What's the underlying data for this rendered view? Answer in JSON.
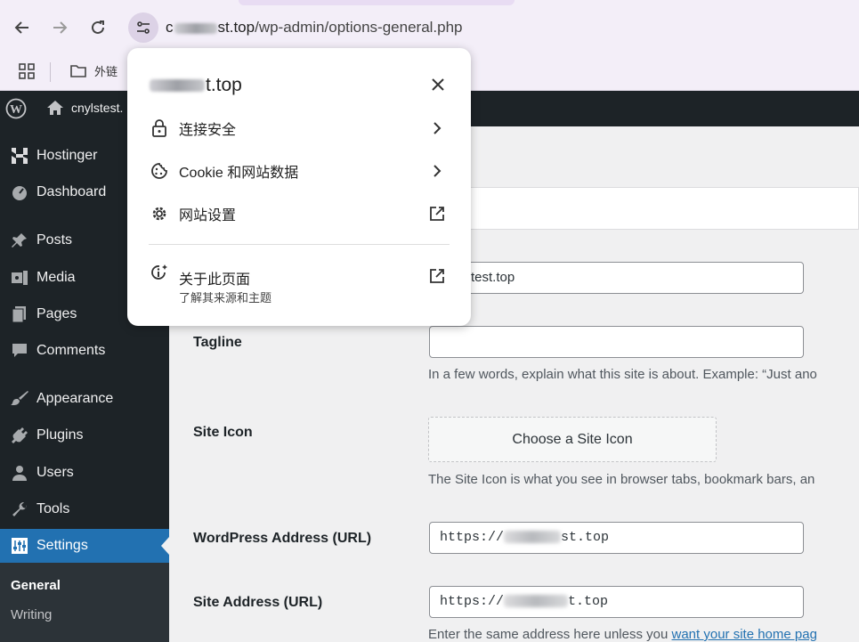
{
  "browser": {
    "url_host_start": "c",
    "url_host_end": "st.top",
    "url_path": "/wp-admin/options-general.php",
    "bookmark_folder": "外链"
  },
  "adminbar": {
    "site_name": "cnylstest."
  },
  "popup": {
    "site_domain_end": "t.top",
    "items": [
      {
        "label": "连接安全"
      },
      {
        "label": "Cookie 和网站数据"
      },
      {
        "label": "网站设置"
      }
    ],
    "about_label": "关于此页面",
    "about_sub": "了解其来源和主题"
  },
  "sidebar": {
    "items": [
      {
        "label": "Hostinger",
        "icon": "hostinger-icon"
      },
      {
        "label": "Dashboard",
        "icon": "dashboard-icon"
      },
      {
        "label": "Posts",
        "icon": "pin-icon"
      },
      {
        "label": "Media",
        "icon": "media-icon"
      },
      {
        "label": "Pages",
        "icon": "pages-icon"
      },
      {
        "label": "Comments",
        "icon": "comment-icon"
      },
      {
        "label": "Appearance",
        "icon": "brush-icon"
      },
      {
        "label": "Plugins",
        "icon": "plugin-icon"
      },
      {
        "label": "Users",
        "icon": "user-icon"
      },
      {
        "label": "Tools",
        "icon": "wrench-icon"
      },
      {
        "label": "Settings",
        "icon": "settings-icon"
      }
    ],
    "submenu": [
      {
        "label": "General"
      },
      {
        "label": "Writing"
      }
    ]
  },
  "form": {
    "site_title_value": "test.top",
    "tagline_label": "Tagline",
    "tagline_value": "",
    "tagline_desc": "In a few words, explain what this site is about. Example: “Just ano",
    "site_icon_label": "Site Icon",
    "site_icon_button": "Choose a Site Icon",
    "site_icon_desc": "The Site Icon is what you see in browser tabs, bookmark bars, an",
    "wp_address_label": "WordPress Address (URL)",
    "wp_address_prefix": "https://",
    "wp_address_suffix": "st.top",
    "site_address_label": "Site Address (URL)",
    "site_address_prefix": "https://",
    "site_address_suffix": "t.top",
    "site_address_desc": "Enter the same address here unless you ",
    "site_address_link": "want your site home pag"
  },
  "colors": {
    "admin_dark": "#1d2327",
    "accent_blue": "#2271b1",
    "chrome_bg": "#f3eef8"
  }
}
